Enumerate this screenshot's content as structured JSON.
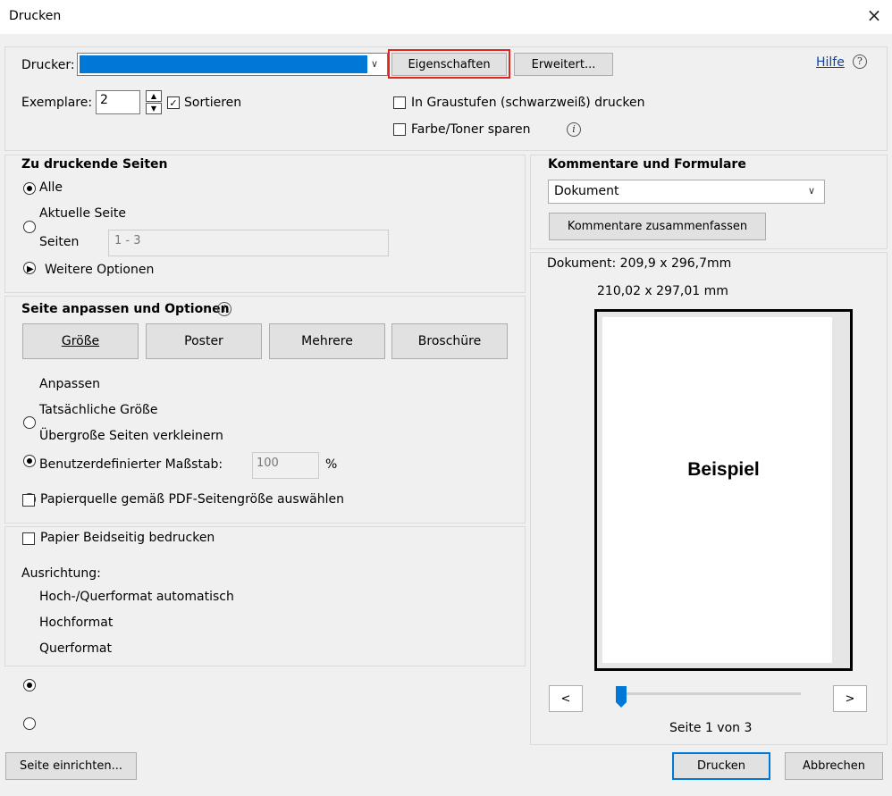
{
  "window": {
    "title": "Drucken",
    "close_icon": "×"
  },
  "printer": {
    "label": "Drucker:",
    "value": "",
    "properties_button": "Eigenschaften",
    "advanced_button": "Erweitert...",
    "help_link": "Hilfe",
    "help_icon": "?"
  },
  "copies": {
    "label": "Exemplare:",
    "value": "2",
    "collate_label": "Sortieren",
    "collate_checked": true
  },
  "grayscale_label": "In Graustufen (schwarzweiß) drucken",
  "save_toner_label": "Farbe/Toner sparen",
  "pages": {
    "heading": "Zu druckende Seiten",
    "all": "Alle",
    "current": "Aktuelle Seite",
    "range": "Seiten",
    "range_placeholder": "1 - 3",
    "more_options": "Weitere Optionen",
    "selected": "all"
  },
  "fit": {
    "heading": "Seite anpassen und Optionen",
    "buttons": [
      "Größe",
      "Poster",
      "Mehrere",
      "Broschüre"
    ],
    "fit_option": "Anpassen",
    "actual_size": "Tatsächliche Größe",
    "shrink": "Übergroße Seiten verkleinern",
    "custom_scale": "Benutzerdefinierter Maßstab:",
    "scale_value": "100",
    "scale_unit": "%",
    "paper_source": "Papierquelle gemäß PDF-Seitengröße auswählen",
    "selected": "actual_size"
  },
  "duplex": {
    "label": "Papier Beidseitig bedrucken",
    "orientation_label": "Ausrichtung:",
    "auto": "Hoch-/Querformat automatisch",
    "portrait": "Hochformat",
    "landscape": "Querformat",
    "selected": "auto"
  },
  "comments": {
    "heading": "Kommentare und Formulare",
    "selected_value": "Dokument",
    "summarize_button": "Kommentare zusammenfassen"
  },
  "preview": {
    "document_size": "Dokument: 209,9 x 296,7mm",
    "paper_size": "210,02 x 297,01 mm",
    "sample_text": "Beispiel",
    "prev_button": "<",
    "next_button": ">",
    "page_indicator": "Seite 1 von 3",
    "slider_position": 0
  },
  "footer": {
    "page_setup": "Seite einrichten...",
    "print": "Drucken",
    "cancel": "Abbrechen"
  },
  "colors": {
    "accent": "#0078d7",
    "highlight": "#e0261f",
    "link": "#0645ad"
  }
}
